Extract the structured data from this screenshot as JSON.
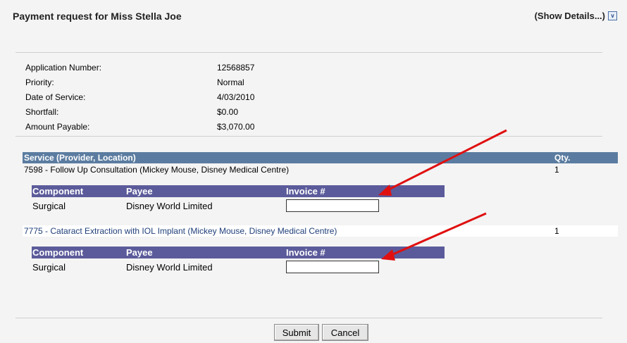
{
  "header": {
    "title": "Payment request for Miss Stella Joe",
    "show_details": "(Show Details...)"
  },
  "info": [
    {
      "label": "Application Number:",
      "value": "12568857"
    },
    {
      "label": "Priority:",
      "value": "Normal"
    },
    {
      "label": "Date of Service:",
      "value": "4/03/2010"
    },
    {
      "label": "Shortfall:",
      "value": "$0.00"
    },
    {
      "label": "Amount Payable:",
      "value": "$3,070.00"
    }
  ],
  "services": {
    "col_service": "Service (Provider, Location)",
    "col_qty": "Qty.",
    "items": [
      {
        "name": "7598 - Follow Up Consultation (Mickey Mouse, Disney Medical Centre)",
        "qty": "1",
        "components": {
          "col_component": "Component",
          "col_payee": "Payee",
          "col_invoice": "Invoice #",
          "rows": [
            {
              "component": "Surgical",
              "payee": "Disney World Limited",
              "invoice": ""
            }
          ]
        }
      },
      {
        "name": "7775 - Cataract Extraction with IOL Implant (Mickey Mouse, Disney Medical Centre)",
        "qty": "1",
        "components": {
          "col_component": "Component",
          "col_payee": "Payee",
          "col_invoice": "Invoice #",
          "rows": [
            {
              "component": "Surgical",
              "payee": "Disney World Limited",
              "invoice": ""
            }
          ]
        }
      }
    ]
  },
  "buttons": {
    "submit": "Submit",
    "cancel": "Cancel"
  },
  "colors": {
    "arrow": "#e01010",
    "service_header": "#5b7ca0",
    "component_header": "#5b5b9b"
  },
  "icons": {
    "expand": "chevron-down-icon"
  }
}
